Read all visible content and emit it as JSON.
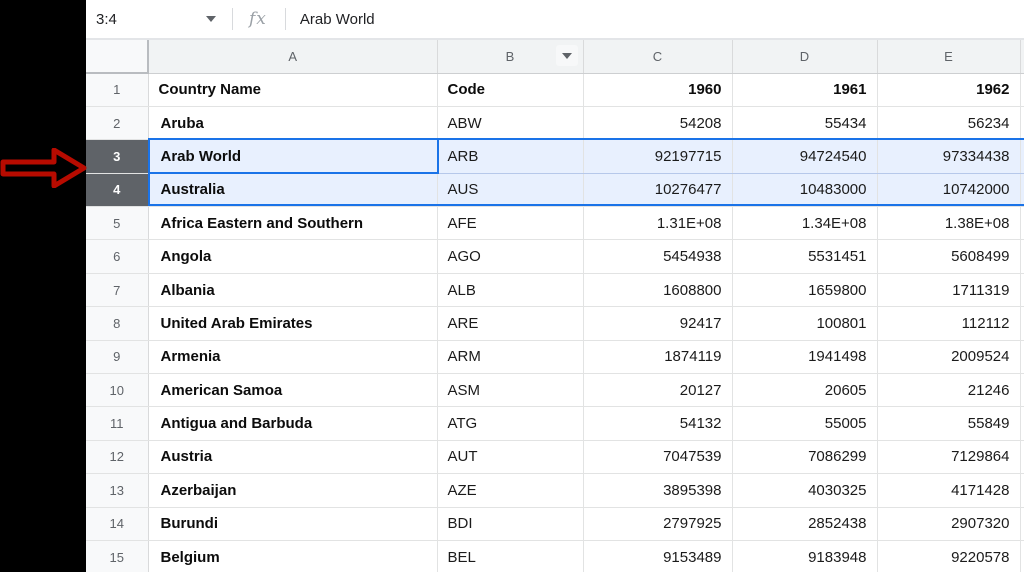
{
  "formula_bar": {
    "name_box_value": "3:4",
    "fx_icon_label": "fx",
    "formula_value": "Arab World"
  },
  "grid": {
    "column_letters": [
      "A",
      "B",
      "C",
      "D",
      "E"
    ],
    "header_row": {
      "row_number": "1",
      "country_label": "Country Name",
      "code_label": "Code",
      "year_labels": [
        "1960",
        "1961",
        "1962"
      ]
    },
    "rows": [
      {
        "row_number": "2",
        "country": "Aruba",
        "code": "ABW",
        "values": [
          "54208",
          "55434",
          "56234"
        ],
        "selected": false
      },
      {
        "row_number": "3",
        "country": "Arab World",
        "code": "ARB",
        "values": [
          "92197715",
          "94724540",
          "97334438"
        ],
        "selected": true
      },
      {
        "row_number": "4",
        "country": "Australia",
        "code": "AUS",
        "values": [
          "10276477",
          "10483000",
          "10742000"
        ],
        "selected": true
      },
      {
        "row_number": "5",
        "country": "Africa Eastern and Southern",
        "code": "AFE",
        "values": [
          "1.31E+08",
          "1.34E+08",
          "1.38E+08"
        ],
        "selected": false
      },
      {
        "row_number": "6",
        "country": "Angola",
        "code": "AGO",
        "values": [
          "5454938",
          "5531451",
          "5608499"
        ],
        "selected": false
      },
      {
        "row_number": "7",
        "country": "Albania",
        "code": "ALB",
        "values": [
          "1608800",
          "1659800",
          "1711319"
        ],
        "selected": false
      },
      {
        "row_number": "8",
        "country": "United Arab Emirates",
        "code": "ARE",
        "values": [
          "92417",
          "100801",
          "112112"
        ],
        "selected": false
      },
      {
        "row_number": "9",
        "country": "Armenia",
        "code": "ARM",
        "values": [
          "1874119",
          "1941498",
          "2009524"
        ],
        "selected": false
      },
      {
        "row_number": "10",
        "country": "American Samoa",
        "code": "ASM",
        "values": [
          "20127",
          "20605",
          "21246"
        ],
        "selected": false
      },
      {
        "row_number": "11",
        "country": "Antigua and Barbuda",
        "code": "ATG",
        "values": [
          "54132",
          "55005",
          "55849"
        ],
        "selected": false
      },
      {
        "row_number": "12",
        "country": "Austria",
        "code": "AUT",
        "values": [
          "7047539",
          "7086299",
          "7129864"
        ],
        "selected": false
      },
      {
        "row_number": "13",
        "country": "Azerbaijan",
        "code": "AZE",
        "values": [
          "3895398",
          "4030325",
          "4171428"
        ],
        "selected": false
      },
      {
        "row_number": "14",
        "country": "Burundi",
        "code": "BDI",
        "values": [
          "2797925",
          "2852438",
          "2907320"
        ],
        "selected": false
      },
      {
        "row_number": "15",
        "country": "Belgium",
        "code": "BEL",
        "values": [
          "9153489",
          "9183948",
          "9220578"
        ],
        "selected": false
      }
    ],
    "selection": {
      "selected_row_numbers": [
        "3",
        "4"
      ],
      "range_label": "3:4",
      "active_cell": "A3"
    }
  },
  "colors": {
    "selection_border": "#1a73e8",
    "selection_tint": "#e8f0fe",
    "selected_row_header_bg": "#5f6368",
    "annotation_arrow": "#b70b00"
  }
}
